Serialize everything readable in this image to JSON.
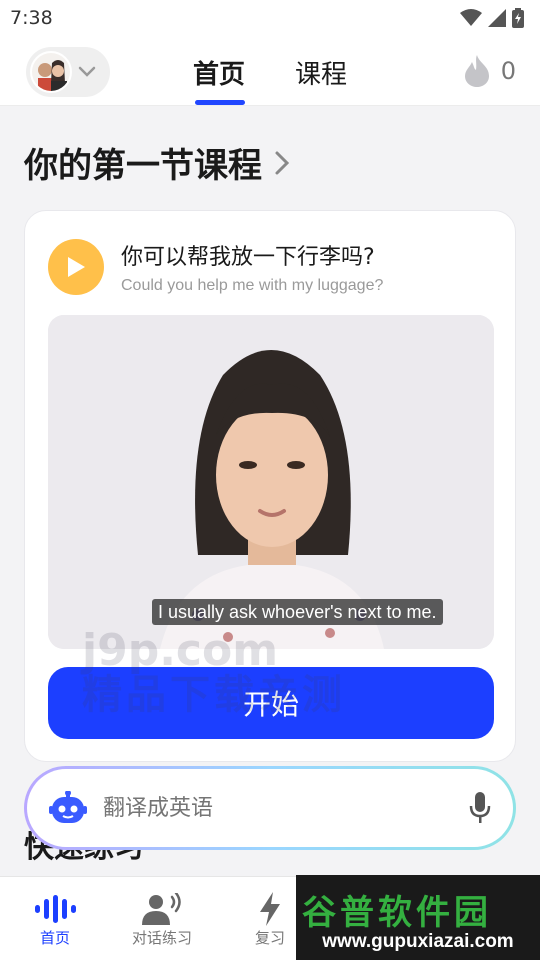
{
  "status": {
    "time": "7:38"
  },
  "header": {
    "tabs": [
      {
        "label": "首页",
        "active": true
      },
      {
        "label": "课程",
        "active": false
      }
    ],
    "streak_count": "0"
  },
  "section": {
    "title": "你的第一节课程"
  },
  "lesson": {
    "sentence_zh": "你可以帮我放一下行李吗?",
    "sentence_en": "Could you help me with my luggage?",
    "video_subtitle": "I usually ask whoever's next to me.",
    "start_label": "开始"
  },
  "watermark": {
    "line1": "j9p.com",
    "line2": "精品下载亲测"
  },
  "next_section": {
    "title_partial": "快速练习"
  },
  "ai_input": {
    "placeholder": "翻译成英语"
  },
  "bottom_nav": {
    "items": [
      {
        "label": "首页",
        "icon": "voice-wave-icon",
        "active": true
      },
      {
        "label": "对话练习",
        "icon": "speaking-person-icon",
        "active": false
      },
      {
        "label": "复习",
        "icon": "lightning-icon",
        "active": false
      }
    ]
  },
  "brand_overlay": {
    "name": "谷普软件园",
    "url": "www.gupuxiazai.com"
  },
  "colors": {
    "accent": "#1c3fff",
    "play": "#ffc04a",
    "brand_green": "#34b040"
  }
}
